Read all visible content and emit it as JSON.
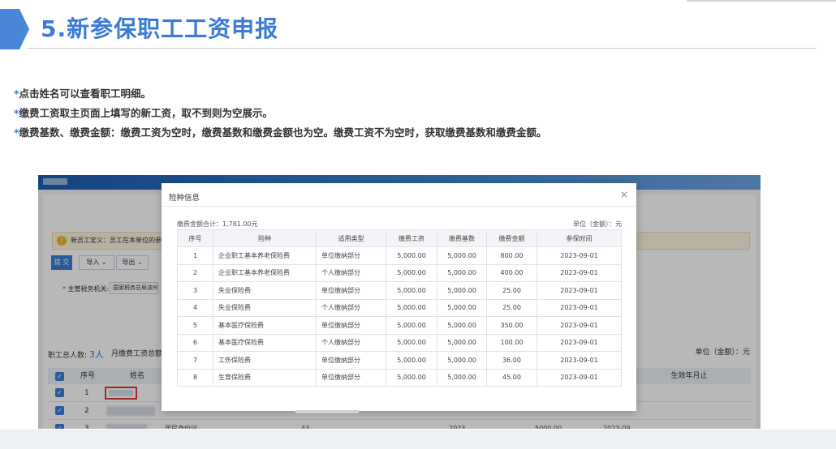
{
  "slide": {
    "title": "5.新参保职工工资申报",
    "notes": [
      "点击姓名可以查看职工明细。",
      "缴费工资取主页面上填写的新工资，取不到则为空展示。",
      "缴费基数、缴费金额：缴费工资为空时，缴费基数和缴费金额也为空。缴费工资不为空时，获取缴费基数和缴费金额。"
    ],
    "note_marker": "*"
  },
  "app": {
    "notice_text": "新员工定义：员工在本单位的参保时",
    "buttons": {
      "submit": "提 交",
      "import": "导入 ⌄",
      "export": "导出 ⌄"
    },
    "field_label": "主管税务机关:",
    "field_value": "国家税务总局滨州",
    "summary_label": "职工总人数:",
    "summary_count": "3人",
    "summary_wage_label": "月缴费工资总额",
    "unit_label": "单位（金额）：元",
    "table_headers": {
      "index": "序号",
      "name": "姓名",
      "effective": "生效年月止"
    },
    "rows": [
      {
        "index": "1"
      },
      {
        "index": "2"
      },
      {
        "index": "3"
      }
    ],
    "row3_visible": {
      "id_type": "居民身份证",
      "age": "43",
      "year": "2023",
      "amount": "5000.00",
      "date": "2023-09"
    }
  },
  "modal": {
    "title": "险种信息",
    "close": "×",
    "total_label": "缴费金额合计：1,781.00元",
    "unit_label": "单位（金额）：元",
    "headers": [
      "序号",
      "险种",
      "适用类型",
      "缴费工资",
      "缴费基数",
      "缴费金额",
      "参保时间"
    ],
    "rows": [
      [
        "1",
        "企业职工基本养老保险费",
        "单位缴纳部分",
        "5,000.00",
        "5,000.00",
        "800.00",
        "2023-09-01"
      ],
      [
        "2",
        "企业职工基本养老保险费",
        "个人缴纳部分",
        "5,000.00",
        "5,000.00",
        "400.00",
        "2023-09-01"
      ],
      [
        "3",
        "失业保险费",
        "单位缴纳部分",
        "5,000.00",
        "5,000.00",
        "25.00",
        "2023-09-01"
      ],
      [
        "4",
        "失业保险费",
        "个人缴纳部分",
        "5,000.00",
        "5,000.00",
        "25.00",
        "2023-09-01"
      ],
      [
        "5",
        "基本医疗保险费",
        "单位缴纳部分",
        "5,000.00",
        "5,000.00",
        "350.00",
        "2023-09-01"
      ],
      [
        "6",
        "基本医疗保险费",
        "个人缴纳部分",
        "5,000.00",
        "5,000.00",
        "100.00",
        "2023-09-01"
      ],
      [
        "7",
        "工伤保险费",
        "单位缴纳部分",
        "5,000.00",
        "5,000.00",
        "36.00",
        "2023-09-01"
      ],
      [
        "8",
        "生育保险费",
        "单位缴纳部分",
        "5,000.00",
        "5,000.00",
        "45.00",
        "2023-09-01"
      ]
    ]
  },
  "colors": {
    "accent": "#3a7bd5",
    "highlight_border": "#d9363e"
  }
}
